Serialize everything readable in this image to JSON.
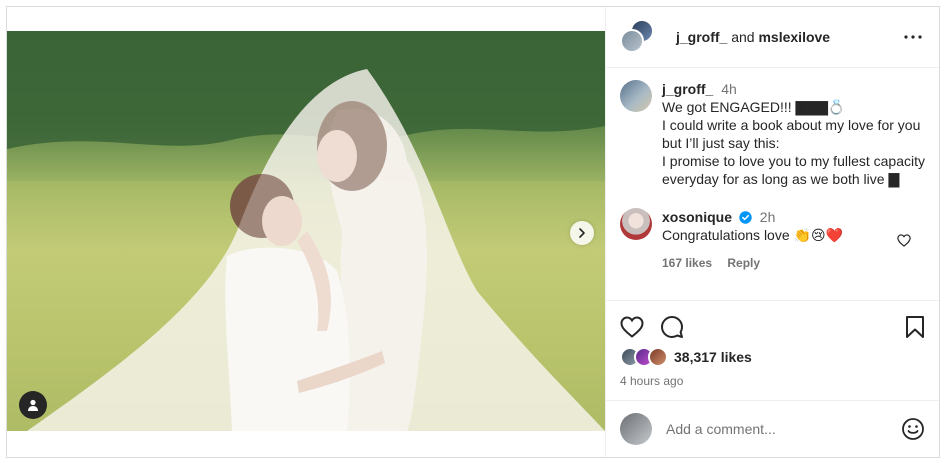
{
  "header": {
    "user1": "j_groff_",
    "joiner": "and",
    "user2": "mslexilove",
    "more_icon": "more-horizontal-icon"
  },
  "caption": {
    "user": "j_groff_",
    "time": "4h",
    "lines": [
      "We got ENGAGED!!! ▇▇▇💍",
      "I could write a book about my love for you but I’ll just say this:",
      "I promise to love you to my fullest capacity everyday for as long as we both live ▇"
    ]
  },
  "comments": [
    {
      "user": "xosonique",
      "verified": true,
      "time": "2h",
      "text": "Congratulations love 👏😢❤️",
      "likes": "167 likes",
      "reply": "Reply"
    }
  ],
  "actions": {
    "like_icon": "heart-icon",
    "comment_icon": "comment-icon",
    "save_icon": "bookmark-icon",
    "likes": "38,317 likes",
    "posted_ago": "4 hours ago"
  },
  "add_comment": {
    "placeholder": "Add a comment...",
    "emoji_icon": "smiley-icon"
  },
  "colors": {
    "text": "#262626",
    "muted": "#737373",
    "border": "#dbdbdb",
    "verified": "#0095f6"
  }
}
